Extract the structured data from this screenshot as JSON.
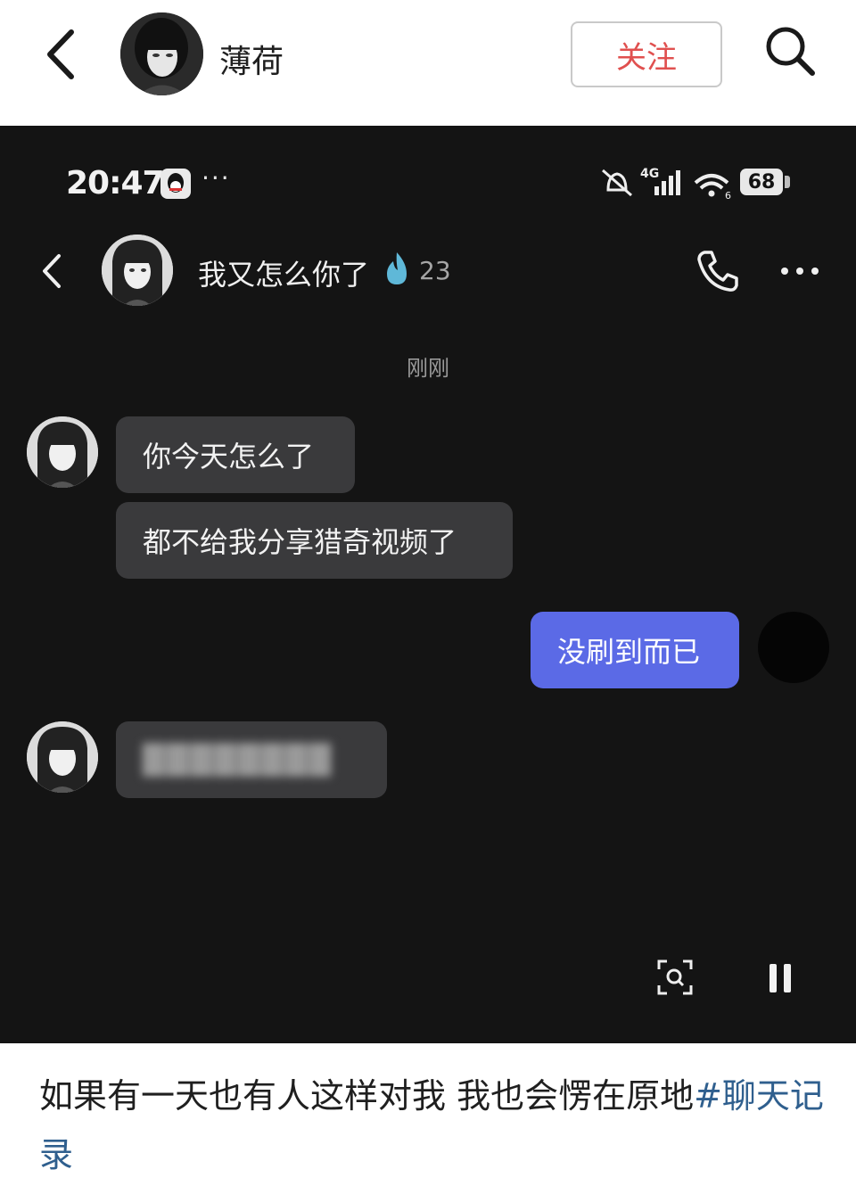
{
  "header": {
    "author_name": "薄荷",
    "follow_label": "关注"
  },
  "screenshot": {
    "status_bar": {
      "time": "20:47",
      "dots": "···",
      "network": "4G",
      "battery": "68"
    },
    "chat_header": {
      "contact_name": "我又怎么你了",
      "streak_count": "23"
    },
    "timestamp": "刚刚",
    "messages": [
      {
        "side": "incoming",
        "text": "你今天怎么了"
      },
      {
        "side": "incoming",
        "text": "都不给我分享猎奇视频了"
      },
      {
        "side": "outgoing",
        "text": "没刷到而已"
      },
      {
        "side": "incoming",
        "text": "████████",
        "blurred": true
      }
    ]
  },
  "caption": {
    "text": "如果有一天也有人这样对我 我也会愣在原地",
    "hashtag": "#聊天记录"
  },
  "colors": {
    "follow_text": "#e0504f",
    "outgoing_bubble": "#5b6ae6",
    "incoming_bubble": "#3a3a3c",
    "hashtag": "#2f5f8e",
    "streak_fire": "#5fb8d8"
  },
  "icons": [
    "back-icon",
    "search-icon",
    "qq-icon",
    "mute-icon",
    "signal-icon",
    "wifi-icon",
    "battery-icon",
    "fire-icon",
    "phone-icon",
    "more-icon",
    "scan-icon",
    "pause-icon"
  ]
}
